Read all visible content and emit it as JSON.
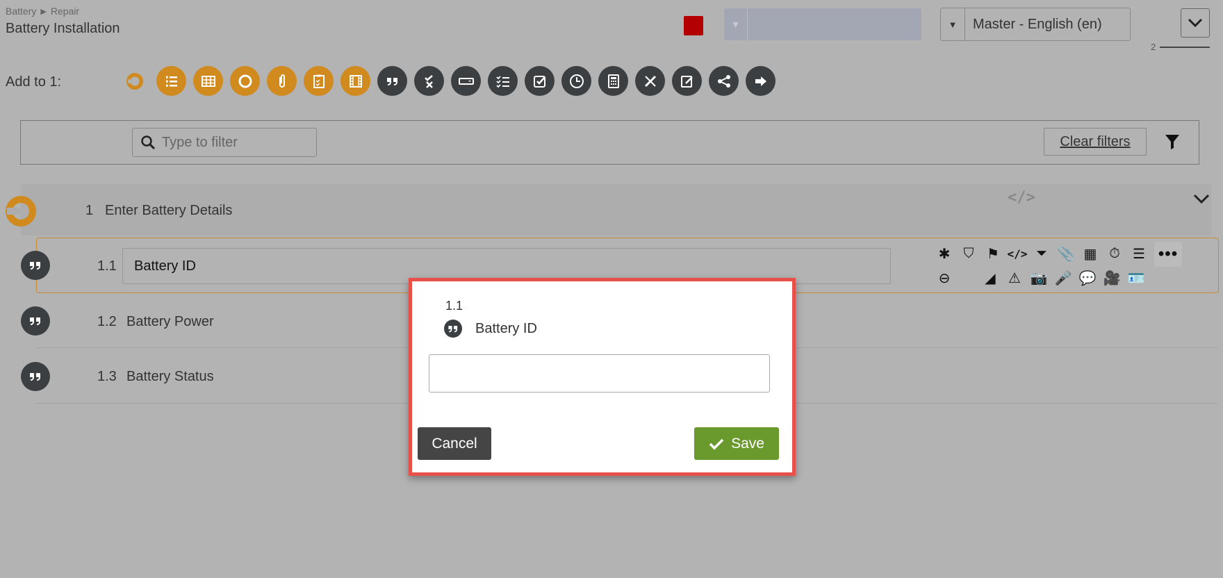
{
  "breadcrumb": {
    "parent": "Battery",
    "separator": "▶",
    "current": "Repair"
  },
  "page_title": "Battery Installation",
  "language_select": {
    "caret": "▼",
    "value": "Master - English (en)"
  },
  "disabled_select": {
    "caret": "▼"
  },
  "page_indicator": "2",
  "add_to": {
    "label": "Add to 1:"
  },
  "toolbar_icons": [
    {
      "name": "section-icon",
      "color": "orange"
    },
    {
      "name": "numbered-list-icon",
      "color": "orange"
    },
    {
      "name": "table-icon",
      "color": "orange"
    },
    {
      "name": "circle-icon",
      "color": "orange"
    },
    {
      "name": "attachment-icon",
      "color": "orange"
    },
    {
      "name": "clipboard-checklist-icon",
      "color": "orange"
    },
    {
      "name": "film-icon",
      "color": "orange"
    },
    {
      "name": "quote-icon",
      "color": "dark"
    },
    {
      "name": "check-x-icon",
      "color": "dark"
    },
    {
      "name": "input-field-icon",
      "color": "dark"
    },
    {
      "name": "checklist-icon",
      "color": "dark"
    },
    {
      "name": "checkbox-icon",
      "color": "dark"
    },
    {
      "name": "clock-icon",
      "color": "dark"
    },
    {
      "name": "calculator-icon",
      "color": "dark"
    },
    {
      "name": "ruler-pencil-icon",
      "color": "dark"
    },
    {
      "name": "edit-icon",
      "color": "dark"
    },
    {
      "name": "share-icon",
      "color": "dark"
    },
    {
      "name": "arrow-right-icon",
      "color": "dark"
    }
  ],
  "filter": {
    "placeholder": "Type to filter",
    "clear_label": "Clear filters"
  },
  "section": {
    "number": "1",
    "title": "Enter Battery Details"
  },
  "items": [
    {
      "number": "1.1",
      "title": "Battery ID"
    },
    {
      "number": "1.2",
      "title": "Battery Power"
    },
    {
      "number": "1.3",
      "title": "Battery Status"
    }
  ],
  "item_actions_row1": [
    "✱",
    "⛉",
    "⚑",
    "</>",
    "⏷",
    "📎",
    "▦",
    "⏱",
    "☰"
  ],
  "item_actions_row2": [
    "⊖",
    "◢",
    "⚠",
    "📷",
    "🎤",
    "💬",
    "🎥",
    "🪪"
  ],
  "more_label": "•••",
  "code_label": "</>",
  "modal": {
    "number": "1.1",
    "title": "Battery ID",
    "input_value": "",
    "cancel_label": "Cancel",
    "save_label": "Save"
  },
  "colors": {
    "accent_orange": "#d08a1e",
    "dark_circle": "#3b3f42",
    "modal_border": "#e8514a",
    "save_green": "#6a9a2e",
    "cancel_gray": "#454545",
    "red_square": "#b30000"
  }
}
